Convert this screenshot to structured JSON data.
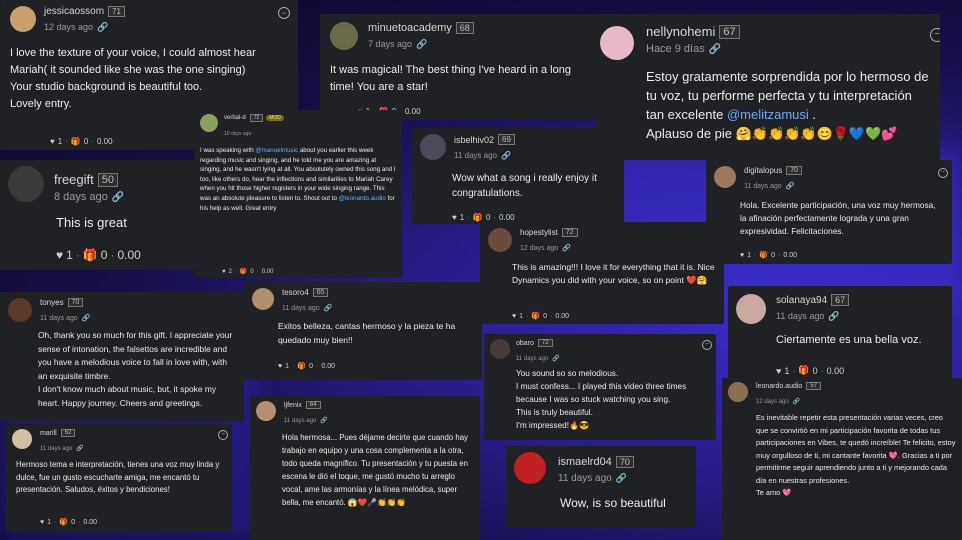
{
  "comments": [
    {
      "user": "jessicaossom",
      "level": "71",
      "time": "12 days ago",
      "avatar_color": "#c9a06a",
      "text": "I love the texture of your voice, I could almost hear Mariah( it sounded like she was the one singing)\nYour studio background is beautiful too.\nLovely entry.",
      "likes": "1",
      "gifts": "0",
      "earnings": "0.00"
    },
    {
      "user": "minuetoacademy",
      "level": "68",
      "time": "7 days ago",
      "avatar_color": "#6b6b4a",
      "text": "It was magical! The best thing I've heard in a long time! You are a star!",
      "likes": "1",
      "gifts": "0",
      "earnings": "0.00"
    },
    {
      "user": "nellynohemi",
      "level": "67",
      "time": "Hace 9 días",
      "avatar_color": "#e8b8c8",
      "text_pre": "Estoy gratamente sorprendida por lo hermoso de tu voz, tu performe perfecta y tu interpretación tan excelente ",
      "mention": "@melitzamusi",
      "text_post": " .\nAplauso de pie 🤗👏👏👏👏😊🌹💙💚💕"
    },
    {
      "user": "freegift",
      "level": "50",
      "time": "8 days ago",
      "avatar_color": "#3a3a3a",
      "text": "This is great",
      "likes": "1",
      "gifts": "0",
      "earnings": "0.00"
    },
    {
      "user": "verbal-d",
      "level": "72",
      "badge": "MOD",
      "time": "10 days ago",
      "avatar_color": "#8aa060",
      "text_pre": "I was speaking with ",
      "mention": "@manuelmusic",
      "text_mid": " about you earlier this week regarding music and singing, and he told me you are amazing at singing, and he wasn't lying at all. You absolutely owned this song and I too, like others do, hear the inflections and similarities to Mariah Carey when you hit those higher registers in your wide singing range. This was an absolute pleasure to listen to. Shout out to ",
      "mention2": "@leonardo.audio",
      "text_post": " for his help as well. Great entry",
      "likes": "2",
      "gifts": "0",
      "earnings": "0.00"
    },
    {
      "user": "isbelhiv02",
      "level": "69",
      "time": "11 days ago",
      "avatar_color": "#4a4a5a",
      "text": "Wow what a song i really enjoy it congratulations.",
      "likes": "1",
      "gifts": "0",
      "earnings": "0.00"
    },
    {
      "user": "digitalopus",
      "level": "70",
      "time": "11 days ago",
      "avatar_color": "#9a7a5a",
      "text": "Hola. Excelente participación, una voz muy hermosa, la afinación perfectamente lograda y una gran expresividad. Felicitaciones.",
      "likes": "1",
      "gifts": "0",
      "earnings": "0.00"
    },
    {
      "user": "hopestylist",
      "level": "72",
      "time": "12 days ago",
      "avatar_color": "#6a4a3a",
      "text": "This is amazing!!! I love it for everything that it is. Nice Dynamics you did with your voice, so on point ❤️🤗",
      "likes": "1",
      "gifts": "0",
      "earnings": "0.00"
    },
    {
      "user": "tonyes",
      "level": "70",
      "time": "11 days ago",
      "avatar_color": "#5a3a2a",
      "text": "Oh, thank you so much for this gift. I appreciate your sense of intonation, the falsettos are incredible and you have a melodious voice to fall in love with, with an exquisite timbre.\nI don't know much about music, but, it spoke my heart. Happy journey. Cheers and greetings.",
      "likes": "1",
      "gifts": "0",
      "earnings": "0.00"
    },
    {
      "user": "tesoro4",
      "level": "65",
      "time": "11 days ago",
      "avatar_color": "#b0906a",
      "text": "Exitos belleza, cantas hermoso y la pieza te ha quedado muy bien!!",
      "likes": "1",
      "gifts": "0",
      "earnings": "0.00"
    },
    {
      "user": "solanaya94",
      "level": "67",
      "time": "11 days ago",
      "avatar_color": "#c8a8a0",
      "text": "Ciertamente es una bella voz.",
      "likes": "1",
      "gifts": "0",
      "earnings": "0.00"
    },
    {
      "user": "obaro",
      "level": "72",
      "time": "11 days ago",
      "avatar_color": "#4a3a3a",
      "text": "You sound so so melodious.\nI must confess... I played this video three times because I was so stuck watching you sing.\nThis is truly beautiful.\nI'm impressed!🔥😎"
    },
    {
      "user": "leonardo.audio",
      "level": "57",
      "time": "12 days ago",
      "avatar_color": "#8a7050",
      "text": "Es inevitable repetir esta presentación varias veces, creo que se convirtió en mi participación favorita de todas tus participaciones en Vibes, te quedó increíble! Te felicito, estoy muy orgulloso de ti, mi cantante favorita 💖. Gracias a ti por permitirme seguir aprendiendo junto a ti y mejorando cada día en nuestras profesiones.\nTe amo 💖"
    },
    {
      "user": "marill",
      "level": "62",
      "time": "11 days ago",
      "avatar_color": "#d0c0a0",
      "text": "Hermoso tema e interpretación, tienes una voz muy linda y dulce, fue un gusto escucharte amiga, me encantó tu presentación. Saludos, éxitos y bendiciones!",
      "likes": "1",
      "gifts": "0",
      "earnings": "0.00"
    },
    {
      "user": "ljfenix",
      "level": "64",
      "time": "11 days ago",
      "avatar_color": "#b89070",
      "text": "Hola hermosa... Pues déjame decirte que cuando hay trabajo en equipo y una cosa complementa a la otra, todo queda magnífico. Tu presentación y tu puesta en escena le dió el toque, me gustó mucho tu arreglo vocal, ame las armonías y la línea melódica, super bella, me encantó. 😱❤️🎤👏👏👏"
    },
    {
      "user": "ismaelrd04",
      "level": "70",
      "time": "11 days ago",
      "avatar_color": "#c02020",
      "text": "Wow, is so beautiful"
    }
  ]
}
